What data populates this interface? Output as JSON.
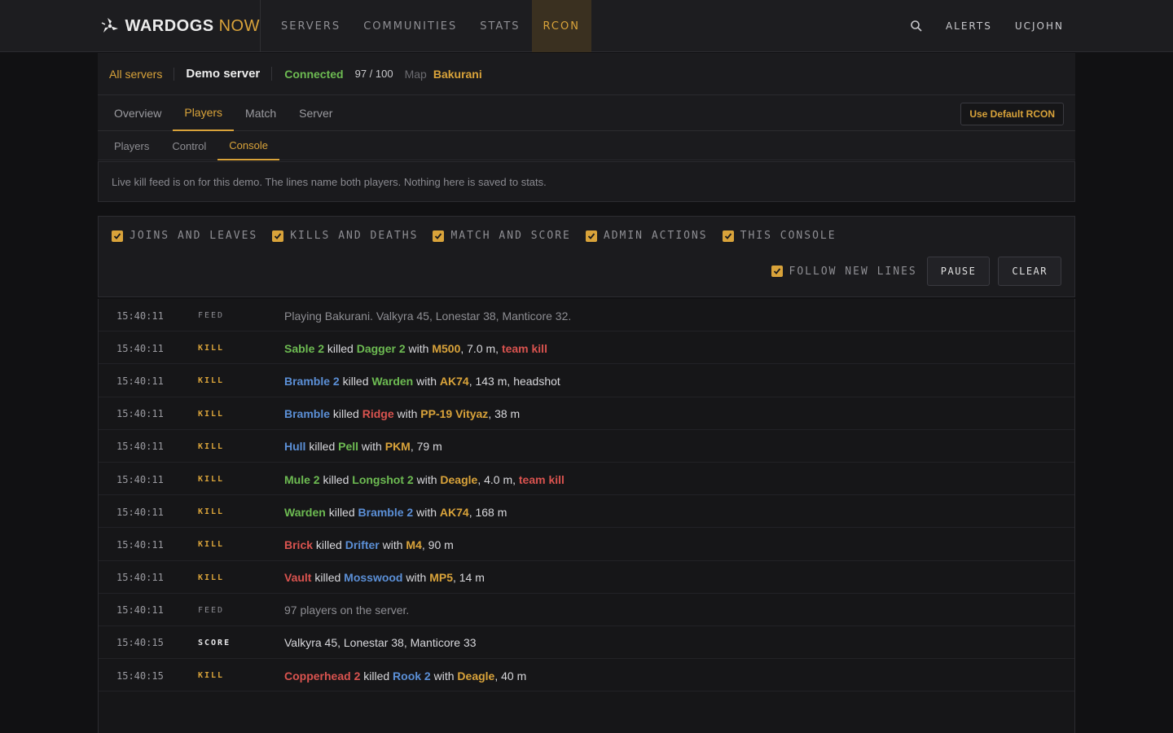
{
  "brand": {
    "name_a": "WARDOGS",
    "name_b": "NOW"
  },
  "nav": {
    "items": [
      "SERVERS",
      "COMMUNITIES",
      "STATS",
      "RCON"
    ],
    "alerts": "ALERTS",
    "user": "UCJOHN"
  },
  "server": {
    "all_servers": "All servers",
    "name": "Demo server",
    "status": "Connected",
    "players": "97 / 100",
    "map_label": "Map",
    "map": "Bakurani"
  },
  "tabs": [
    "Overview",
    "Players",
    "Match",
    "Server"
  ],
  "use_default": "Use Default RCON",
  "subtabs": [
    "Players",
    "Control",
    "Console"
  ],
  "notice": "Live kill feed is on for this demo. The lines name both players. Nothing here is saved to stats.",
  "filters": [
    "JOINS AND LEAVES",
    "KILLS AND DEATHS",
    "MATCH AND SCORE",
    "ADMIN ACTIONS",
    "THIS CONSOLE"
  ],
  "follow": "FOLLOW NEW LINES",
  "pause": "PAUSE",
  "clear": "CLEAR",
  "colors": {
    "accent": "#d9a33a",
    "green": "#6dbb52",
    "blue": "#5b8fd6",
    "red": "#d9534f"
  },
  "log": [
    {
      "time": "15:40:11",
      "type": "FEED",
      "text": "Playing Bakurani. Valkyra 45, Lonestar 38, Manticore 32."
    },
    {
      "time": "15:40:11",
      "type": "KILL",
      "killer": "Sable 2",
      "kc": "g",
      "victim": "Dagger 2",
      "vc": "g",
      "weapon": "M500",
      "dist": "7.0 m",
      "extra": "team kill"
    },
    {
      "time": "15:40:11",
      "type": "KILL",
      "killer": "Bramble 2",
      "kc": "b",
      "victim": "Warden",
      "vc": "g",
      "weapon": "AK74",
      "dist": "143 m",
      "extra": "headshot"
    },
    {
      "time": "15:40:11",
      "type": "KILL",
      "killer": "Bramble",
      "kc": "b",
      "victim": "Ridge",
      "vc": "r",
      "weapon": "PP-19 Vityaz",
      "dist": "38 m",
      "extra": ""
    },
    {
      "time": "15:40:11",
      "type": "KILL",
      "killer": "Hull",
      "kc": "b",
      "victim": "Pell",
      "vc": "g",
      "weapon": "PKM",
      "dist": "79 m",
      "extra": ""
    },
    {
      "time": "15:40:11",
      "type": "KILL",
      "killer": "Mule 2",
      "kc": "g",
      "victim": "Longshot 2",
      "vc": "g",
      "weapon": "Deagle",
      "dist": "4.0 m",
      "extra": "team kill"
    },
    {
      "time": "15:40:11",
      "type": "KILL",
      "killer": "Warden",
      "kc": "g",
      "victim": "Bramble 2",
      "vc": "b",
      "weapon": "AK74",
      "dist": "168 m",
      "extra": ""
    },
    {
      "time": "15:40:11",
      "type": "KILL",
      "killer": "Brick",
      "kc": "r",
      "victim": "Drifter",
      "vc": "b",
      "weapon": "M4",
      "dist": "90 m",
      "extra": ""
    },
    {
      "time": "15:40:11",
      "type": "KILL",
      "killer": "Vault",
      "kc": "r",
      "victim": "Mosswood",
      "vc": "b",
      "weapon": "MP5",
      "dist": "14 m",
      "extra": ""
    },
    {
      "time": "15:40:11",
      "type": "FEED",
      "text": "97 players on the server."
    },
    {
      "time": "15:40:15",
      "type": "SCORE",
      "text": "Valkyra 45, Lonestar 38, Manticore 33"
    },
    {
      "time": "15:40:15",
      "type": "KILL",
      "killer": "Copperhead 2",
      "kc": "r",
      "victim": "Rook 2",
      "vc": "b",
      "weapon": "Deagle",
      "dist": "40 m",
      "extra": ""
    }
  ],
  "words": {
    "killed": "killed",
    "with": "with"
  }
}
